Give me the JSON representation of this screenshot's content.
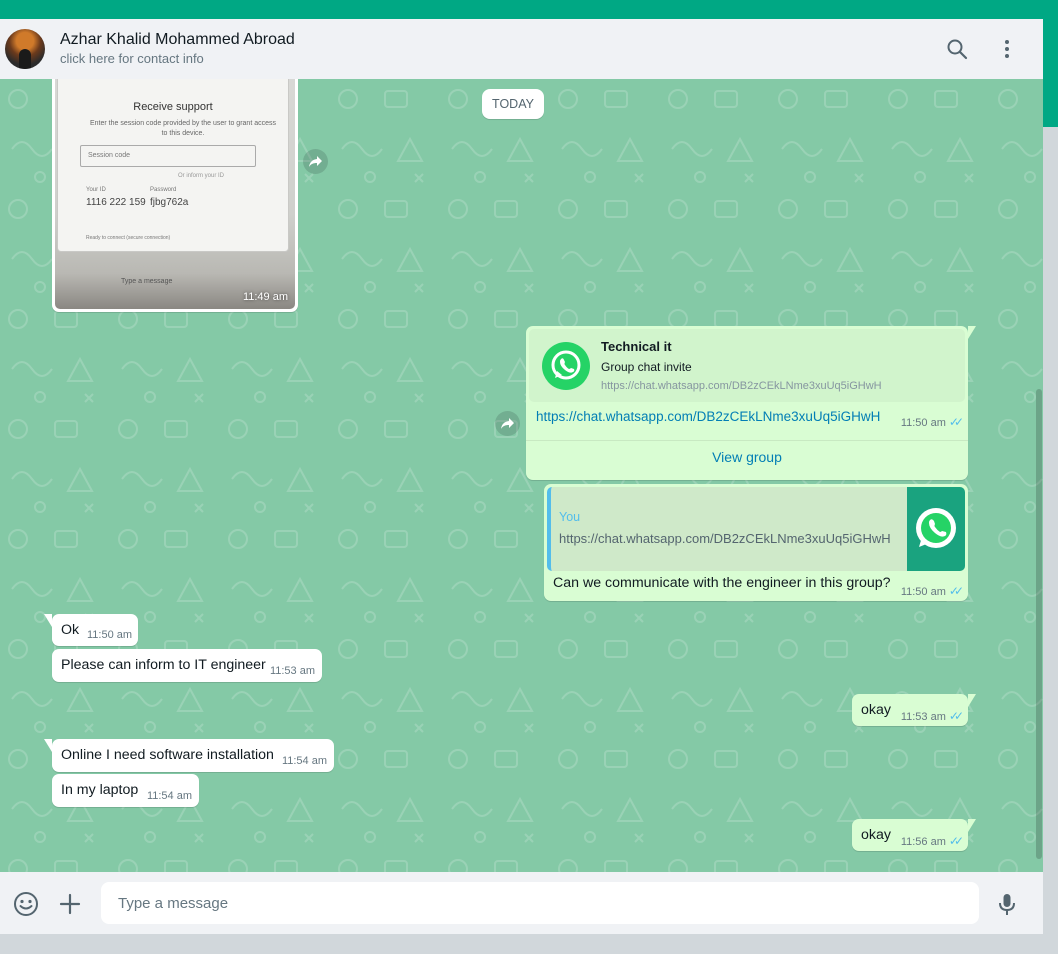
{
  "colors": {
    "accent": "#00a884",
    "chat_bg": "#84c9a6",
    "outgoing": "#d9fdd3",
    "incoming": "#ffffff",
    "link": "#027eb5",
    "read_ticks": "#53bdeb"
  },
  "header": {
    "contact_name": "Azhar Khalid Mohammed Abroad",
    "contact_subtitle": "click here for contact info",
    "icons": [
      "search-icon",
      "kebab-menu-icon"
    ]
  },
  "date_chip": "TODAY",
  "image_message": {
    "time": "11:49 am",
    "screenshot": {
      "title": "Receive support",
      "subtitle": "Enter the session code provided by the user to grant access to this device.",
      "input_placeholder": "Session code",
      "confirm_link": "Or inform your ID",
      "your_id_label": "Your ID",
      "your_id_value": "1116 222 159",
      "password_label": "Password",
      "password_value": "fjbg762a",
      "status": "Ready to connect (secure connection)",
      "bottom_hint": "Type a message"
    }
  },
  "group_invite": {
    "title": "Technical it",
    "subtitle": "Group chat invite",
    "preview_url": "https://chat.whatsapp.com/DB2zCEkLNme3xuUq5iGHwH",
    "link": "https://chat.whatsapp.com/DB2zCEkLNme3xuUq5iGHwH",
    "time": "11:50 am",
    "view_label": "View group"
  },
  "reply_message": {
    "quote_author": "You",
    "quote_text": "https://chat.whatsapp.com/DB2zCEkLNme3xuUq5iGHwH",
    "text": "Can we communicate with the engineer in this group?",
    "time": "11:50 am"
  },
  "messages": [
    {
      "text": "Ok",
      "time": "11:50 am"
    },
    {
      "text": "Please can inform to IT engineer",
      "time": "11:53 am"
    },
    {
      "text": "okay",
      "time": "11:53 am"
    },
    {
      "text": "Online I need software installation",
      "time": "11:54 am"
    },
    {
      "text": "In my laptop",
      "time": "11:54 am"
    },
    {
      "text": "okay",
      "time": "11:56 am"
    }
  ],
  "composer": {
    "placeholder": "Type a message",
    "icons": [
      "emoji-icon",
      "plus-icon",
      "microphone-icon"
    ]
  }
}
